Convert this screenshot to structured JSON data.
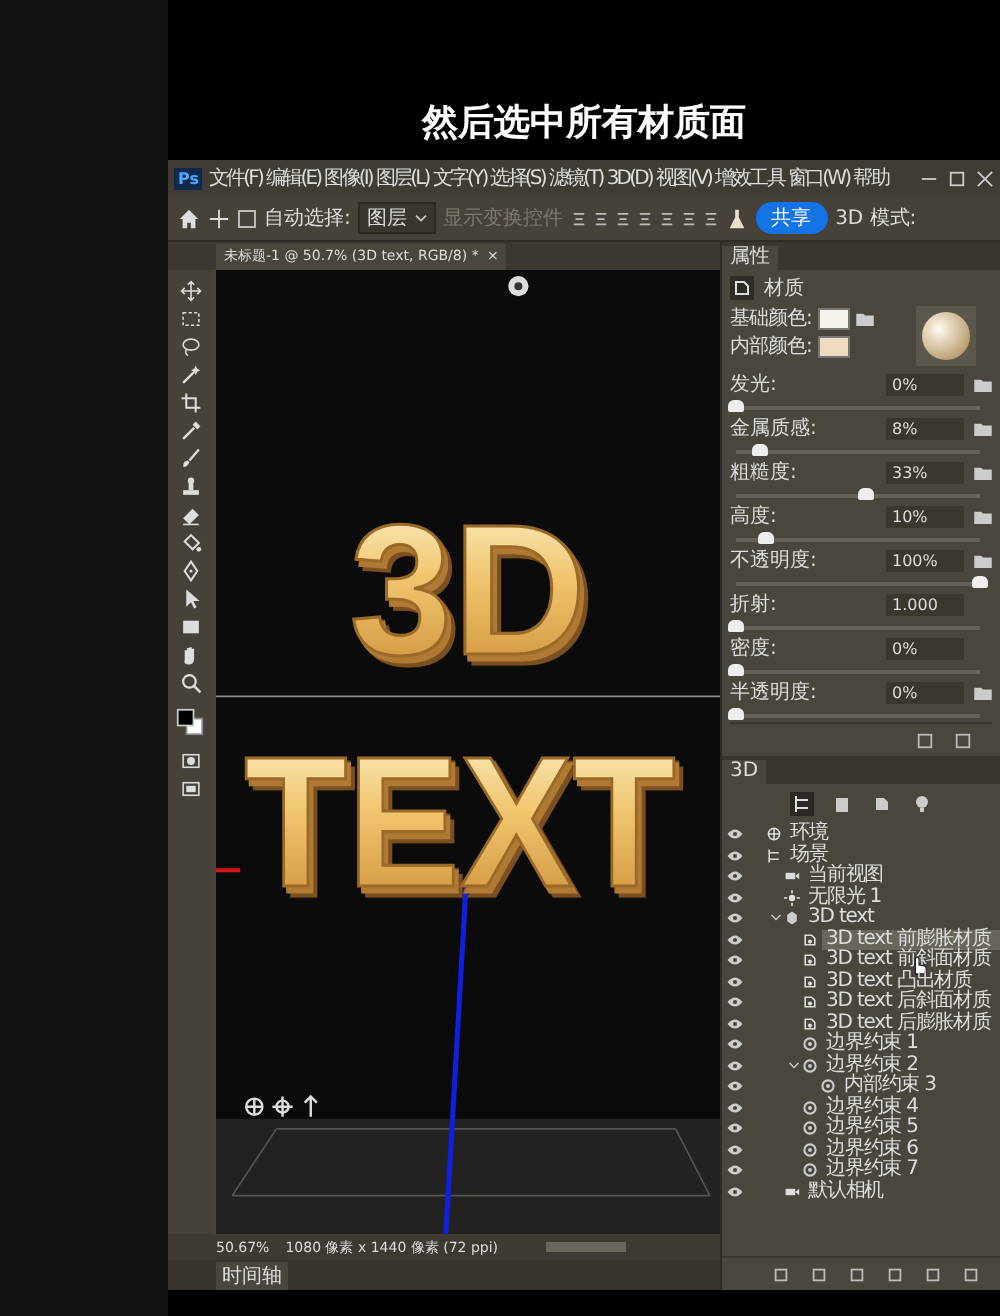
{
  "caption": "然后选中所有材质面",
  "app": {
    "logo": "Ps",
    "menus": [
      "文件(F)",
      "编辑(E)",
      "图像(I)",
      "图层(L)",
      "文字(Y)",
      "选择(S)",
      "滤镜(T)",
      "3D(D)",
      "视图(V)",
      "增效工具",
      "窗口(W)",
      "帮助"
    ]
  },
  "options_bar": {
    "auto_select": {
      "label": "自动选择:",
      "checked": false
    },
    "layer_dropdown": "图层",
    "transform_controls": {
      "label": "显示变换控件",
      "disabled": true
    },
    "share_button": "共享",
    "mode_label": "3D 模式:"
  },
  "document_tab": {
    "title": "未标题-1 @ 50.7% (3D text, RGB/8) *",
    "close": "×"
  },
  "canvas": {
    "line_1": "3D",
    "line_2": "TEXT"
  },
  "status_bar": {
    "zoom": "50.67%",
    "doc_size": "1080 像素 x 1440 像素 (72 ppi)"
  },
  "timeline_tab": "时间轴",
  "properties": {
    "tab": "属性",
    "section": "材质",
    "colors": [
      {
        "label": "基础颜色:",
        "color": "#f6f3ec"
      },
      {
        "label": "内部颜色:",
        "color": "#eddcc0"
      }
    ],
    "sliders": [
      {
        "label": "发光:",
        "value": "0%",
        "level": 0,
        "texture_button": true
      },
      {
        "label": "金属质感:",
        "value": "8%",
        "level": 0.1,
        "texture_button": true
      },
      {
        "label": "粗糙度:",
        "value": "33%",
        "level": 0.53,
        "texture_button": true
      },
      {
        "label": "高度:",
        "value": "10%",
        "level": 0.12,
        "texture_button": true
      },
      {
        "label": "不透明度:",
        "value": "100%",
        "level": 1,
        "texture_button": true
      },
      {
        "label": "折射:",
        "value": "1.000",
        "level": 0,
        "texture_button": false
      },
      {
        "label": "密度:",
        "value": "0%",
        "level": 0,
        "texture_button": false
      },
      {
        "label": "半透明度:",
        "value": "0%",
        "level": 0,
        "texture_button": true
      }
    ]
  },
  "panel_3d": {
    "tab": "3D",
    "tree": [
      {
        "label": "环境",
        "kind": "environment",
        "selected": false
      },
      {
        "label": "场景",
        "kind": "scene",
        "selected": false,
        "children": [
          {
            "label": "当前视图",
            "kind": "camera",
            "selected": false
          },
          {
            "label": "无限光 1",
            "kind": "light",
            "selected": false
          },
          {
            "label": "3D text",
            "kind": "mesh",
            "selected": false,
            "expanded": true,
            "children": [
              {
                "label": "3D text 前膨胀材质",
                "kind": "material",
                "selected": true
              },
              {
                "label": "3D text 前斜面材质",
                "kind": "material",
                "selected": false,
                "hovered": true
              },
              {
                "label": "3D text 凸出材质",
                "kind": "material",
                "selected": false
              },
              {
                "label": "3D text 后斜面材质",
                "kind": "material",
                "selected": false
              },
              {
                "label": "3D text 后膨胀材质",
                "kind": "material",
                "selected": false
              },
              {
                "label": "边界约束 1",
                "kind": "constraint",
                "selected": false
              },
              {
                "label": "边界约束 2",
                "kind": "constraint",
                "selected": false,
                "expanded": true,
                "children": [
                  {
                    "label": "内部约束 3",
                    "kind": "constraint",
                    "selected": false
                  }
                ]
              },
              {
                "label": "边界约束 4",
                "kind": "constraint",
                "selected": false
              },
              {
                "label": "边界约束 5",
                "kind": "constraint",
                "selected": false
              },
              {
                "label": "边界约束 6",
                "kind": "constraint",
                "selected": false
              },
              {
                "label": "边界约束 7",
                "kind": "constraint",
                "selected": false
              }
            ]
          },
          {
            "label": "默认相机",
            "kind": "camera",
            "selected": false
          }
        ]
      }
    ]
  }
}
